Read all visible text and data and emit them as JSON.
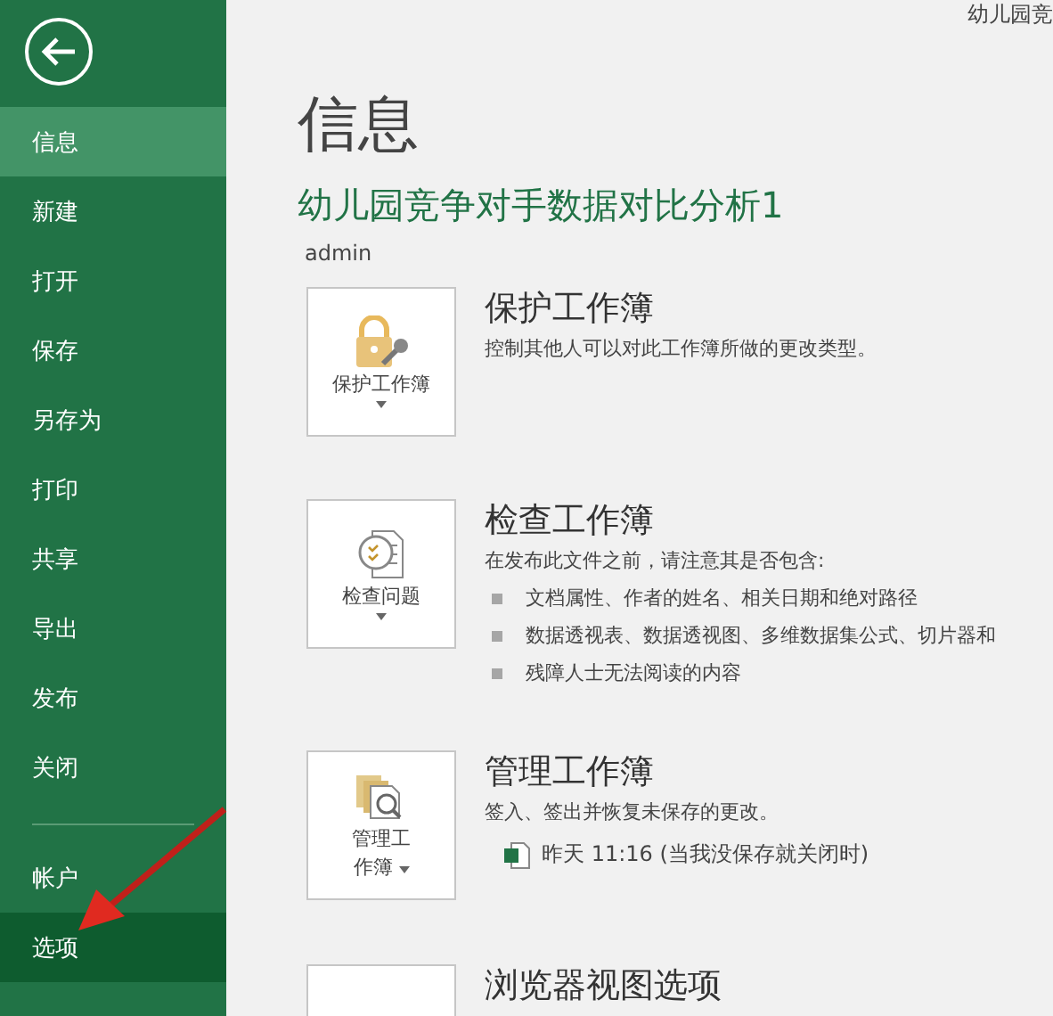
{
  "window": {
    "title": "幼儿园竞"
  },
  "sidebar": {
    "main_items": [
      {
        "label": "信息",
        "selected": true,
        "highlighted": false
      },
      {
        "label": "新建",
        "selected": false,
        "highlighted": false
      },
      {
        "label": "打开",
        "selected": false,
        "highlighted": false
      },
      {
        "label": "保存",
        "selected": false,
        "highlighted": false
      },
      {
        "label": "另存为",
        "selected": false,
        "highlighted": false
      },
      {
        "label": "打印",
        "selected": false,
        "highlighted": false
      },
      {
        "label": "共享",
        "selected": false,
        "highlighted": false
      },
      {
        "label": "导出",
        "selected": false,
        "highlighted": false
      },
      {
        "label": "发布",
        "selected": false,
        "highlighted": false
      },
      {
        "label": "关闭",
        "selected": false,
        "highlighted": false
      }
    ],
    "bottom_items": [
      {
        "label": "帐户",
        "selected": false,
        "highlighted": false
      },
      {
        "label": "选项",
        "selected": false,
        "highlighted": true
      }
    ]
  },
  "page": {
    "title": "信息",
    "file_name": "幼儿园竞争对手数据对比分析1",
    "author": "admin"
  },
  "sections": [
    {
      "kind": "protect",
      "button": [
        "保护工作簿"
      ],
      "title": "保护工作簿",
      "description": "控制其他人可以对此工作簿所做的更改类型。"
    },
    {
      "kind": "inspect",
      "button": [
        "检查问题"
      ],
      "title": "检查工作簿",
      "description": "在发布此文件之前，请注意其是否包含:",
      "bullets": [
        "文档属性、作者的姓名、相关日期和绝对路径",
        "数据透视表、数据透视图、多维数据集公式、切片器和",
        "残障人士无法阅读的内容"
      ]
    },
    {
      "kind": "manage",
      "button": [
        "管理工",
        "作簿"
      ],
      "title": "管理工作簿",
      "description": "签入、签出并恢复未保存的更改。",
      "versions": [
        "昨天 11:16 (当我没保存就关闭时)"
      ]
    },
    {
      "kind": "browser",
      "title": "浏览器视图选项"
    }
  ]
}
